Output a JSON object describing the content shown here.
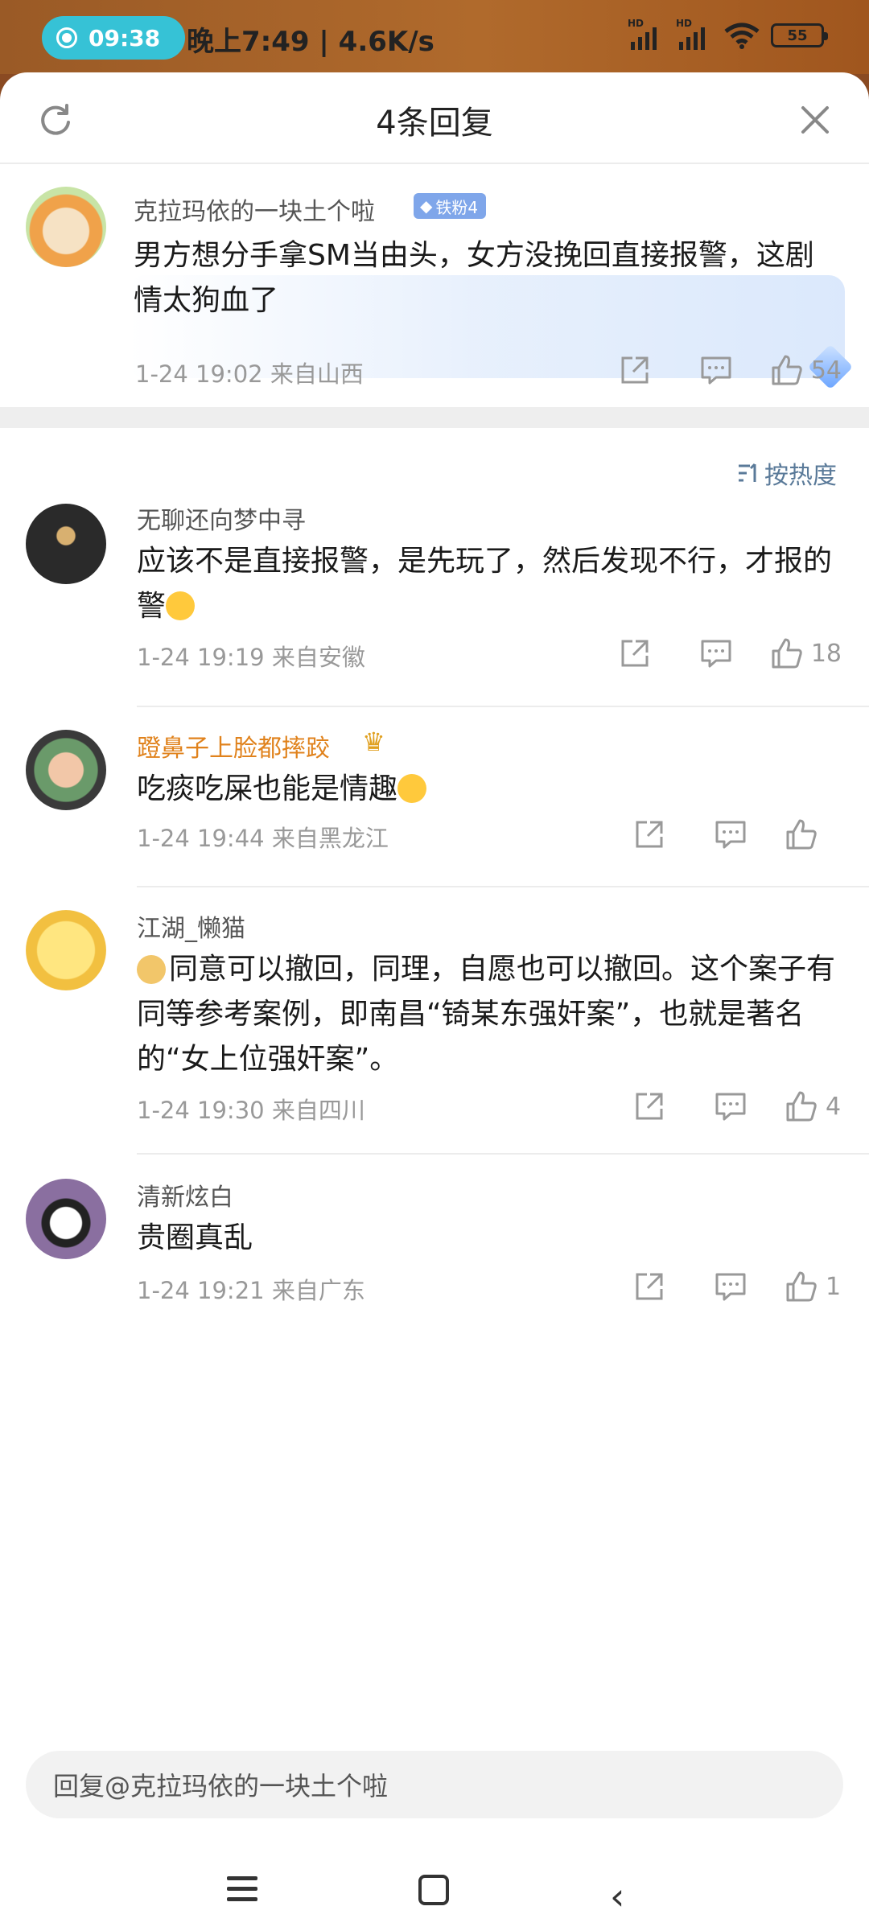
{
  "status_bar": {
    "rec_time": "09:38",
    "info": "晚上7:49 | 4.6K/s",
    "hd1": "HD",
    "hd2": "HD",
    "battery": "55"
  },
  "sheet": {
    "title": "4条回复"
  },
  "root_comment": {
    "username": "克拉玛依的一块土个啦",
    "badge": "铁粉4",
    "text": "男方想分手拿SM当由头，女方没挽回直接报警，这剧情太狗血了",
    "meta": "1-24 19:02  来自山西",
    "likes": "54"
  },
  "sort": {
    "label": "按热度"
  },
  "replies": [
    {
      "username": "无聊还向梦中寻",
      "text": "应该不是直接报警，是先玩了，然后发现不行，才报的警",
      "meta": "1-24 19:19  来自安徽",
      "likes": "18"
    },
    {
      "username": "蹬鼻子上脸都摔跤",
      "text": "吃痰吃屎也能是情趣",
      "meta": "1-24 19:44  来自黑龙江",
      "likes": ""
    },
    {
      "username": "江湖_懒猫",
      "text": "同意可以撤回，同理，自愿也可以撤回。这个案子有同等参考案例，即南昌“锜某东强奸案”，也就是著名的“女上位强奸案”。",
      "meta": "1-24 19:30  来自四川",
      "likes": "4"
    },
    {
      "username": "清新炫白",
      "text": "贵圈真乱",
      "meta": "1-24 19:21  来自广东",
      "likes": "1"
    }
  ],
  "input": {
    "placeholder": "回复@克拉玛依的一块土个啦"
  },
  "colors": {
    "vip_name": "#e0821c",
    "sort_text": "#5a7a99",
    "meta_gray": "#999999",
    "rec_pill": "#36c2d6"
  }
}
